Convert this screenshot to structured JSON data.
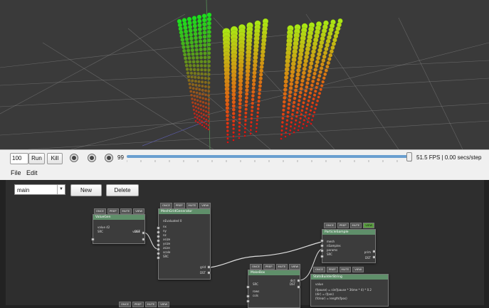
{
  "controls": {
    "steps_value": "100",
    "run_label": "Run",
    "kill_label": "Kill",
    "slider_value_label": "99",
    "slider_fraction": 0.99,
    "fps_text": "51.5 FPS | 0.00 secs/step"
  },
  "menu": {
    "file": "File",
    "edit": "Edit"
  },
  "editor": {
    "selector_value": "main",
    "new_label": "New",
    "delete_label": "Delete",
    "flags": [
      "ONCE",
      "PREP",
      "MUTE",
      "VIEW"
    ],
    "nodes": {
      "n1": {
        "title": "ValueGen",
        "rows": [
          "value",
          "SRC"
        ],
        "value_text": "value  42",
        "outs": [
          "value",
          "DST"
        ]
      },
      "n2": {
        "title": "MeshGridGenerator",
        "rows": [
          "nx",
          "ny",
          "nz",
          "xsize",
          "ysize",
          "zsize",
          "scale",
          "SRC"
        ],
        "count_text": "nEvaluated  0",
        "outs": [
          "grid",
          "DST"
        ]
      },
      "n3": {
        "title": "MakeBox",
        "rows": [
          "SRC",
          "rows",
          "cols"
        ],
        "outs": [
          "dict",
          "DST"
        ]
      },
      "n4": {
        "title": "ParticleSample",
        "rows": [
          "mesh",
          "nSamples",
          "params",
          "SRC"
        ],
        "outs": [
          "prim",
          "DST"
        ]
      },
      "n5": {
        "title": "StatsBuilderString",
        "rows": [
          "value",
          "(fpause) = sin(fpause * 3time * 4) * 0.2",
          "(dir) = (fpos)",
          "(fclear) = length(fpos)"
        ]
      }
    }
  },
  "colors": {
    "viewport_bg": "#3a3a3a",
    "editor_bg": "#2e2e2e",
    "node_header": "#5f8f6a",
    "accent": "#6a9fd0"
  }
}
